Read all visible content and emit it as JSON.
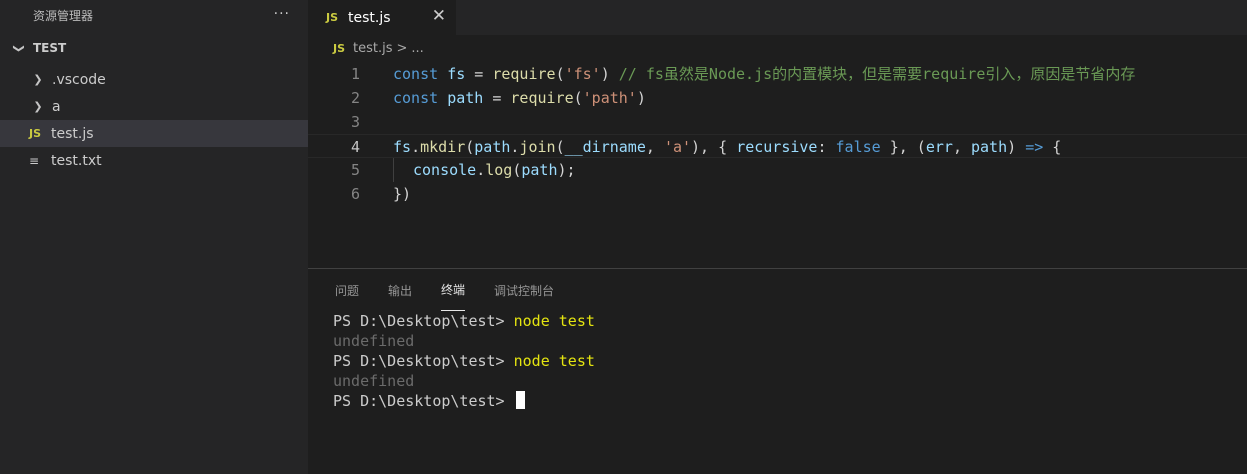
{
  "sidebar": {
    "title": "资源管理器",
    "more": "···",
    "section": "TEST",
    "items": [
      {
        "label": ".vscode"
      },
      {
        "label": "a"
      },
      {
        "label": "test.js"
      },
      {
        "label": "test.txt"
      }
    ]
  },
  "icons": {
    "js": "JS",
    "chevron_down": "❯",
    "chevron_right": "❯",
    "text_file": "≡"
  },
  "tab": {
    "label": "test.js",
    "close": "✕"
  },
  "breadcrumb": {
    "file": "test.js",
    "sep": ">",
    "rest": "..."
  },
  "editor": {
    "line_numbers": [
      "1",
      "2",
      "3",
      "4",
      "5",
      "6"
    ],
    "lines": [
      [
        {
          "t": "const",
          "c": "k"
        },
        {
          "t": " ",
          "c": "p"
        },
        {
          "t": "fs",
          "c": "v"
        },
        {
          "t": " = ",
          "c": "p"
        },
        {
          "t": "require",
          "c": "f"
        },
        {
          "t": "(",
          "c": "p"
        },
        {
          "t": "'fs'",
          "c": "s"
        },
        {
          "t": ") ",
          "c": "p"
        },
        {
          "t": "// fs虽然是Node.js的内置模块，但是需要require引入，原因是节省内存",
          "c": "c"
        }
      ],
      [
        {
          "t": "const",
          "c": "k"
        },
        {
          "t": " ",
          "c": "p"
        },
        {
          "t": "path",
          "c": "v"
        },
        {
          "t": " = ",
          "c": "p"
        },
        {
          "t": "require",
          "c": "f"
        },
        {
          "t": "(",
          "c": "p"
        },
        {
          "t": "'path'",
          "c": "s"
        },
        {
          "t": ")",
          "c": "p"
        }
      ],
      [],
      [
        {
          "t": "fs",
          "c": "v"
        },
        {
          "t": ".",
          "c": "p"
        },
        {
          "t": "mkdir",
          "c": "f"
        },
        {
          "t": "(",
          "c": "p"
        },
        {
          "t": "path",
          "c": "v"
        },
        {
          "t": ".",
          "c": "p"
        },
        {
          "t": "join",
          "c": "f"
        },
        {
          "t": "(",
          "c": "p"
        },
        {
          "t": "__dirname",
          "c": "v"
        },
        {
          "t": ", ",
          "c": "p"
        },
        {
          "t": "'a'",
          "c": "s"
        },
        {
          "t": "), { ",
          "c": "p"
        },
        {
          "t": "recursive",
          "c": "v"
        },
        {
          "t": ": ",
          "c": "p"
        },
        {
          "t": "false",
          "c": "k"
        },
        {
          "t": " }, (",
          "c": "p"
        },
        {
          "t": "err",
          "c": "v"
        },
        {
          "t": ", ",
          "c": "p"
        },
        {
          "t": "path",
          "c": "v"
        },
        {
          "t": ") ",
          "c": "p"
        },
        {
          "t": "=>",
          "c": "k"
        },
        {
          "t": " {",
          "c": "p"
        }
      ],
      [
        {
          "t": "console",
          "c": "v"
        },
        {
          "t": ".",
          "c": "p"
        },
        {
          "t": "log",
          "c": "f"
        },
        {
          "t": "(",
          "c": "p"
        },
        {
          "t": "path",
          "c": "v"
        },
        {
          "t": ");",
          "c": "p"
        }
      ],
      [
        {
          "t": "})",
          "c": "p"
        }
      ]
    ]
  },
  "panel": {
    "tabs": [
      "问题",
      "输出",
      "终端",
      "调试控制台"
    ],
    "terminal": {
      "lines": [
        {
          "prompt": "PS D:\\Desktop\\test> ",
          "cmd": "node test"
        },
        {
          "out": "undefined"
        },
        {
          "prompt": "PS D:\\Desktop\\test> ",
          "cmd": "node test"
        },
        {
          "out": "undefined"
        },
        {
          "prompt": "PS D:\\Desktop\\test> ",
          "cmd": ""
        }
      ]
    }
  },
  "colors": {
    "accent_js": "#cbcb41",
    "keyword": "#569cd6",
    "variable": "#9cdcfe",
    "function": "#dcdcaa",
    "string": "#ce9178",
    "comment": "#6a9955",
    "terminal_cmd": "#e5e510"
  }
}
